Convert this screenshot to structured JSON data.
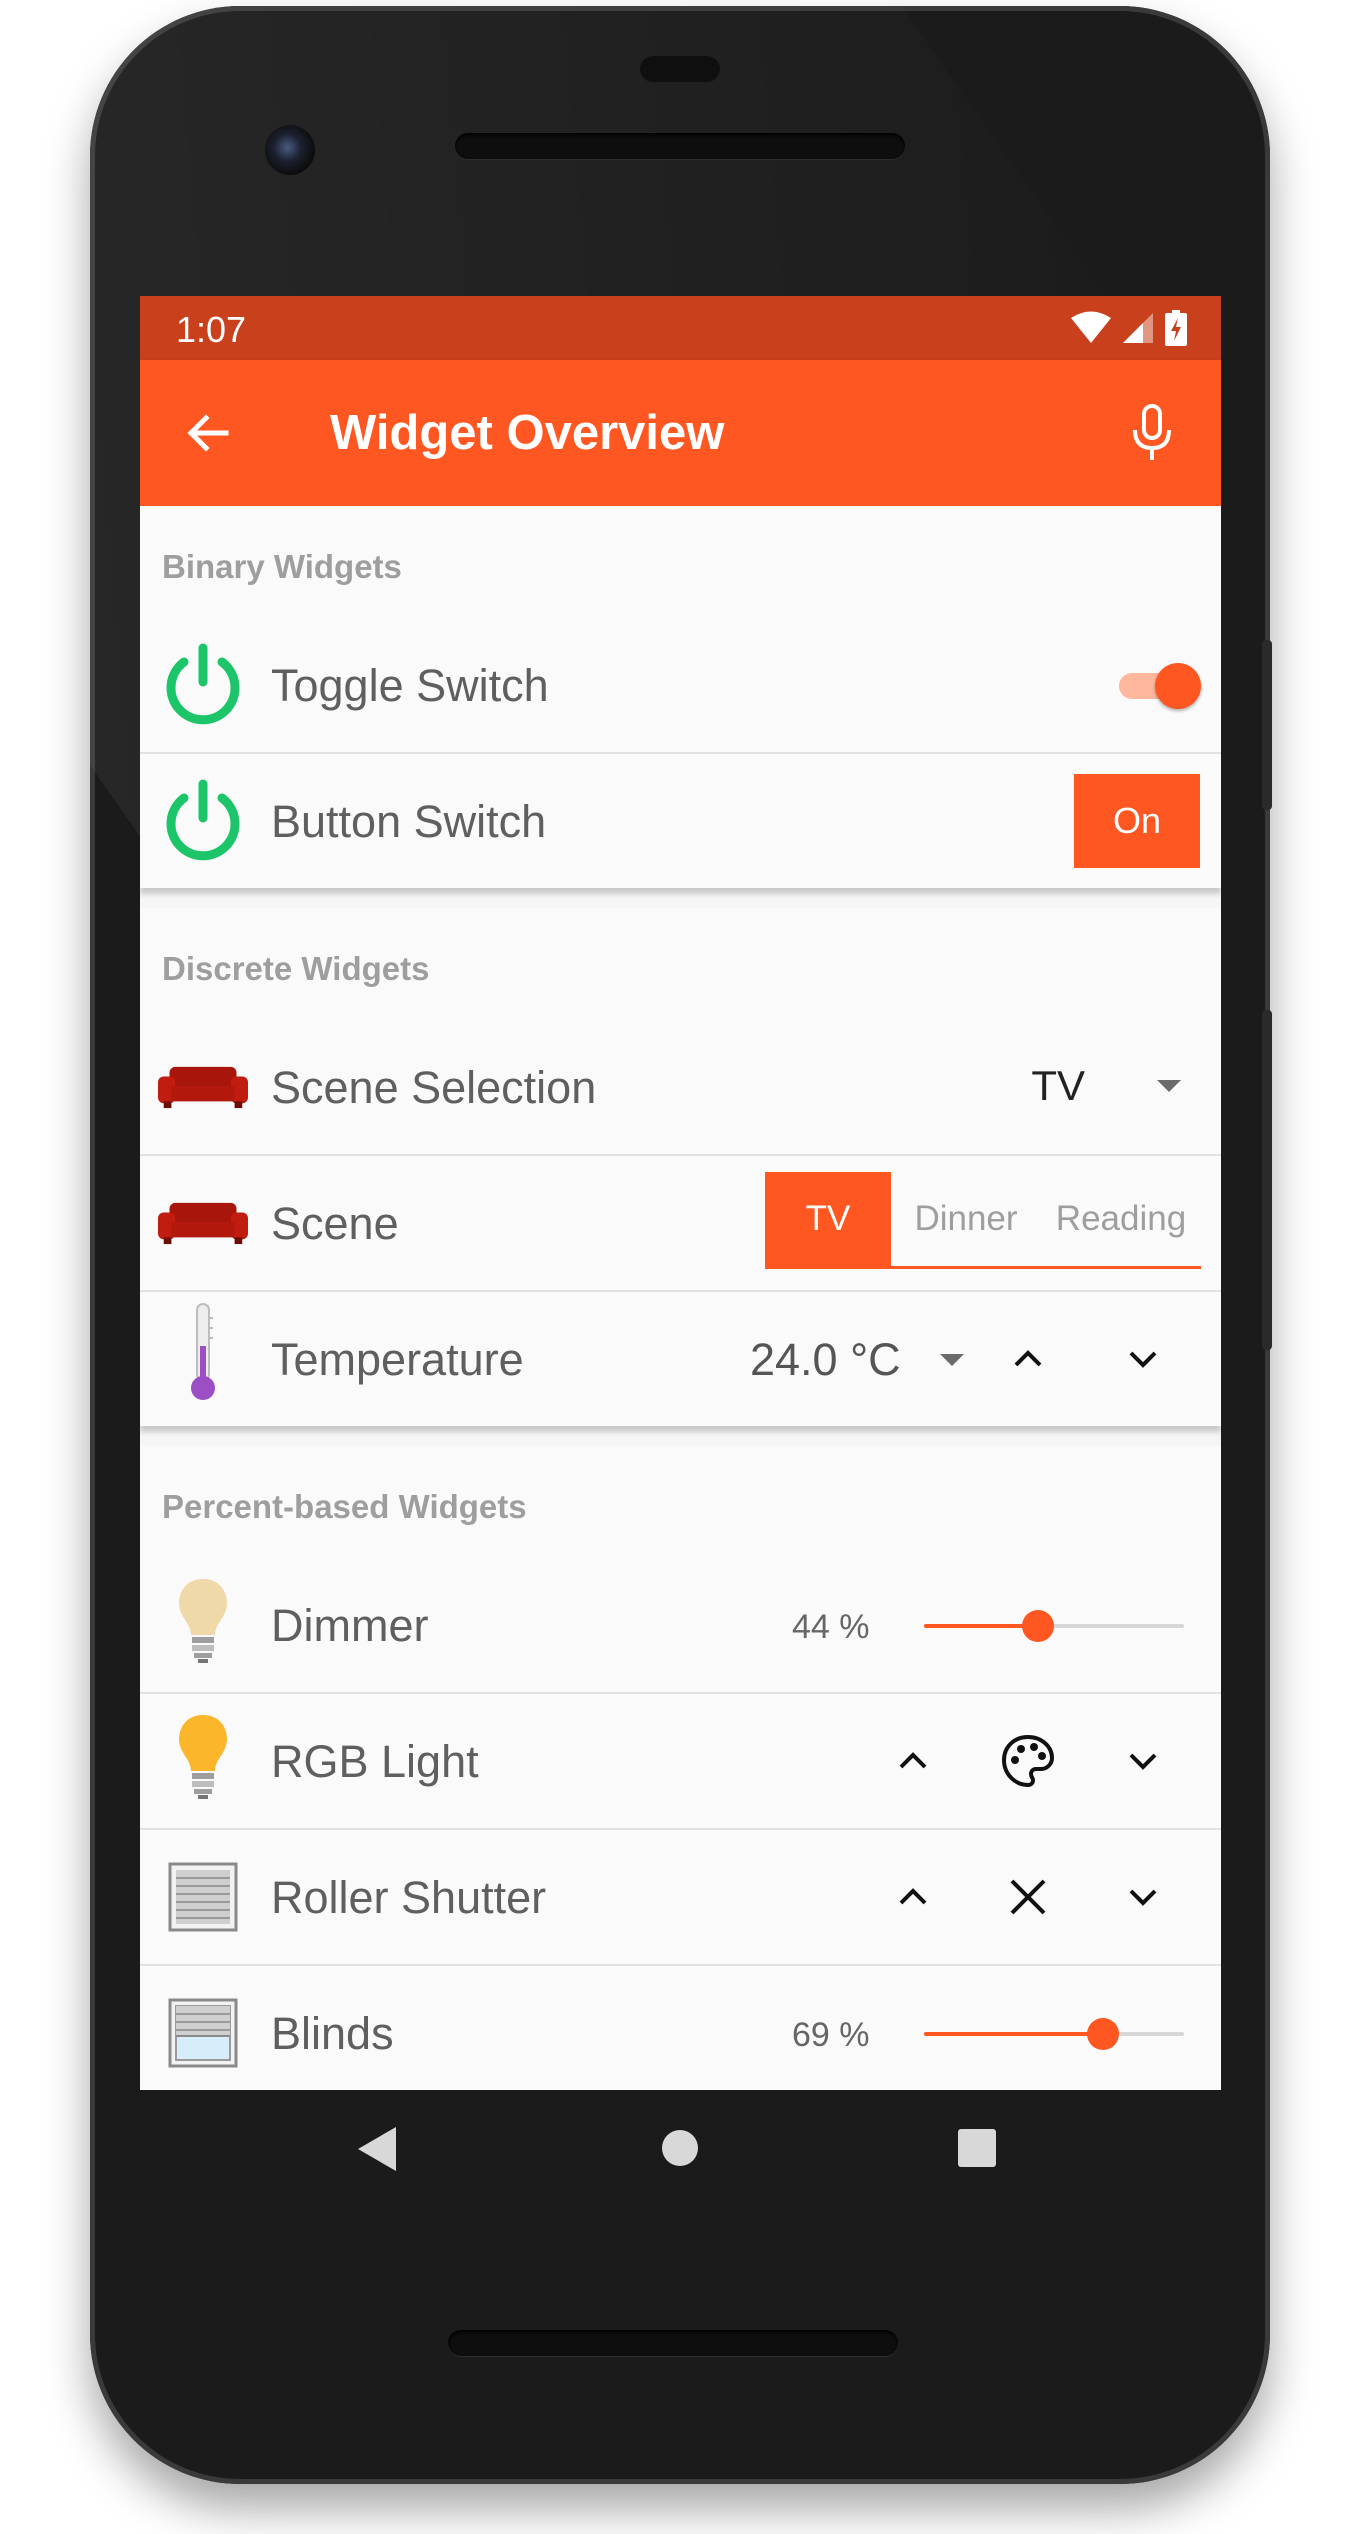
{
  "status_bar": {
    "time": "1:07",
    "icons": [
      "wifi-icon",
      "cell-signal-icon",
      "battery-charging-icon"
    ]
  },
  "toolbar": {
    "title": "Widget Overview",
    "back_icon": "arrow-back-icon",
    "mic_icon": "mic-icon"
  },
  "colors": {
    "accent": "#ff5722",
    "status_bar": "#c8401c",
    "section_header": "#9e9e9e",
    "switch_green": "#1cc46a"
  },
  "sections": {
    "binary": {
      "header": "Binary Widgets",
      "toggle_switch": {
        "label": "Toggle Switch",
        "state": "on",
        "icon": "power-icon"
      },
      "button_switch": {
        "label": "Button Switch",
        "button_label": "On",
        "icon": "power-icon"
      }
    },
    "discrete": {
      "header": "Discrete Widgets",
      "scene_selection": {
        "label": "Scene Selection",
        "selected": "TV",
        "icon": "sofa-icon"
      },
      "scene": {
        "label": "Scene",
        "options": [
          "TV",
          "Dinner",
          "Reading"
        ],
        "selected": "TV",
        "icon": "sofa-icon"
      },
      "temperature": {
        "label": "Temperature",
        "value": "24.0 °C",
        "icon": "thermometer-icon"
      }
    },
    "percent": {
      "header": "Percent-based Widgets",
      "dimmer": {
        "label": "Dimmer",
        "value_text": "44 %",
        "value": 44,
        "icon": "light-bulb-icon"
      },
      "rgb_light": {
        "label": "RGB Light",
        "icon": "light-bulb-on-icon"
      },
      "roller_shutter": {
        "label": "Roller Shutter",
        "icon": "roller-shutter-icon"
      },
      "blinds": {
        "label": "Blinds",
        "value_text": "69 %",
        "value": 69,
        "icon": "blinds-icon"
      }
    }
  },
  "nav_bar": {
    "buttons": [
      "nav-back-icon",
      "nav-home-icon",
      "nav-recents-icon"
    ]
  }
}
